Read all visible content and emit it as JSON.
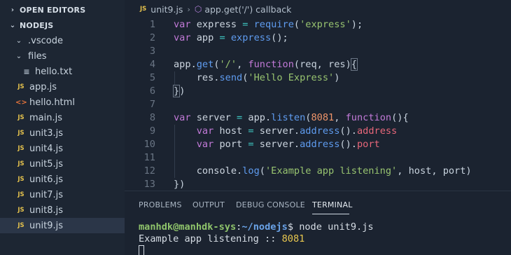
{
  "sidebar": {
    "open_editors_label": "OPEN EDITORS",
    "project_label": "NODEJS",
    "items": [
      {
        "label": ".vscode",
        "kind": "folder"
      },
      {
        "label": "files",
        "kind": "folder"
      },
      {
        "label": "hello.txt",
        "kind": "txt"
      },
      {
        "label": "app.js",
        "kind": "js"
      },
      {
        "label": "hello.html",
        "kind": "html"
      },
      {
        "label": "main.js",
        "kind": "js"
      },
      {
        "label": "unit3.js",
        "kind": "js"
      },
      {
        "label": "unit4.js",
        "kind": "js"
      },
      {
        "label": "unit5.js",
        "kind": "js"
      },
      {
        "label": "unit6.js",
        "kind": "js"
      },
      {
        "label": "unit7.js",
        "kind": "js"
      },
      {
        "label": "unit8.js",
        "kind": "js"
      },
      {
        "label": "unit9.js",
        "kind": "js",
        "active": true
      }
    ]
  },
  "icons": {
    "js_badge": "JS",
    "html_badge": "<>",
    "txt_badge": "≡",
    "chevron_right": "›",
    "chevron_down": "⌄",
    "cube": "⬡"
  },
  "breadcrumb": {
    "file": "unit9.js",
    "symbol": "app.get('/') callback"
  },
  "editor": {
    "lines": [
      {
        "n": "1",
        "tokens": [
          [
            "kw",
            "var"
          ],
          [
            "var",
            " express "
          ],
          [
            "op",
            "="
          ],
          [
            "var",
            " "
          ],
          [
            "fn",
            "require"
          ],
          [
            "punc",
            "("
          ],
          [
            "str",
            "'express'"
          ],
          [
            "punc",
            ");"
          ]
        ]
      },
      {
        "n": "2",
        "tokens": [
          [
            "kw",
            "var"
          ],
          [
            "var",
            " app "
          ],
          [
            "op",
            "="
          ],
          [
            "var",
            " "
          ],
          [
            "fn",
            "express"
          ],
          [
            "punc",
            "();"
          ]
        ]
      },
      {
        "n": "3",
        "tokens": []
      },
      {
        "n": "4",
        "tokens": [
          [
            "var",
            "app"
          ],
          [
            "punc",
            "."
          ],
          [
            "fn",
            "get"
          ],
          [
            "punc",
            "("
          ],
          [
            "str",
            "'/'"
          ],
          [
            "punc",
            ", "
          ],
          [
            "kw",
            "function"
          ],
          [
            "punc",
            "("
          ],
          [
            "prm",
            "req"
          ],
          [
            "punc",
            ", "
          ],
          [
            "prm",
            "res"
          ],
          [
            "punc",
            ")"
          ],
          [
            "brk",
            "{"
          ]
        ]
      },
      {
        "n": "5",
        "tokens": [
          [
            "var",
            "    res"
          ],
          [
            "punc",
            "."
          ],
          [
            "fn",
            "send"
          ],
          [
            "punc",
            "("
          ],
          [
            "str",
            "'Hello Express'"
          ],
          [
            "punc",
            ")"
          ]
        ]
      },
      {
        "n": "6",
        "tokens": [
          [
            "brk",
            "}"
          ],
          [
            "punc",
            ")"
          ]
        ]
      },
      {
        "n": "7",
        "tokens": []
      },
      {
        "n": "8",
        "tokens": [
          [
            "kw",
            "var"
          ],
          [
            "var",
            " server "
          ],
          [
            "op",
            "="
          ],
          [
            "var",
            " app"
          ],
          [
            "punc",
            "."
          ],
          [
            "fn",
            "listen"
          ],
          [
            "punc",
            "("
          ],
          [
            "num",
            "8081"
          ],
          [
            "punc",
            ", "
          ],
          [
            "kw",
            "function"
          ],
          [
            "punc",
            "(){"
          ]
        ]
      },
      {
        "n": "9",
        "tokens": [
          [
            "var",
            "    "
          ],
          [
            "kw",
            "var"
          ],
          [
            "var",
            " host "
          ],
          [
            "op",
            "="
          ],
          [
            "var",
            " server"
          ],
          [
            "punc",
            "."
          ],
          [
            "fn",
            "address"
          ],
          [
            "punc",
            "()."
          ],
          [
            "prop",
            "address"
          ]
        ]
      },
      {
        "n": "10",
        "tokens": [
          [
            "var",
            "    "
          ],
          [
            "kw",
            "var"
          ],
          [
            "var",
            " port "
          ],
          [
            "op",
            "="
          ],
          [
            "var",
            " server"
          ],
          [
            "punc",
            "."
          ],
          [
            "fn",
            "address"
          ],
          [
            "punc",
            "()."
          ],
          [
            "prop",
            "port"
          ]
        ]
      },
      {
        "n": "11",
        "tokens": []
      },
      {
        "n": "12",
        "tokens": [
          [
            "var",
            "    console"
          ],
          [
            "punc",
            "."
          ],
          [
            "fn",
            "log"
          ],
          [
            "punc",
            "("
          ],
          [
            "str",
            "'Example app listening'"
          ],
          [
            "punc",
            ", host, port)"
          ]
        ]
      },
      {
        "n": "13",
        "tokens": [
          [
            "punc",
            "})"
          ]
        ]
      }
    ]
  },
  "panel": {
    "tabs": [
      {
        "label": "PROBLEMS"
      },
      {
        "label": "OUTPUT"
      },
      {
        "label": "DEBUG CONSOLE"
      },
      {
        "label": "TERMINAL",
        "active": true
      }
    ],
    "terminal": {
      "user": "manhdk@manhdk-sys",
      "sep": ":",
      "path": "~/nodejs",
      "prompt": "$ ",
      "command": "node unit9.js",
      "output_text": "Example app listening :: ",
      "output_value": "8081"
    }
  },
  "colors": {
    "background": "#1b2330",
    "sidebar": "#1d2633",
    "keyword": "#c27ad8",
    "string": "#98c470",
    "function": "#5f9cf0",
    "number": "#f0956a",
    "property": "#e8677a",
    "js_icon": "#e5c24d",
    "html_icon": "#e4733b"
  }
}
